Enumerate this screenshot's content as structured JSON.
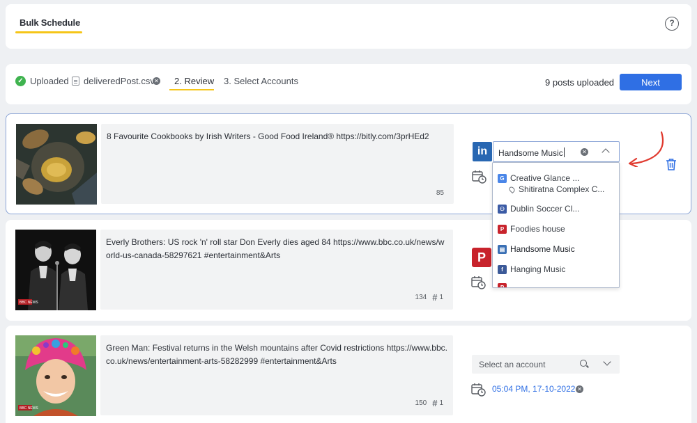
{
  "header": {
    "tab_label": "Bulk Schedule",
    "help_label": "?"
  },
  "steps": {
    "uploaded_label": "Uploaded",
    "file_name": "deliveredPost.csv",
    "step2_label": "2. Review",
    "step3_label": "3. Select Accounts",
    "posts_count_text": "9  posts uploaded",
    "next_label": "Next"
  },
  "posts": [
    {
      "text": "8 Favourite Cookbooks by Irish Writers - Good Food Ireland® https://bitly.com/3prHEd2",
      "char_count": "85",
      "network": "linkedin",
      "network_glyph": "in",
      "account_value": "Handsome Music"
    },
    {
      "text": "Everly Brothers: US rock 'n' roll star Don Everly dies aged 84 https://www.bbc.co.uk/news/world-us-canada-58297621 #entertainment&Arts",
      "char_count": "134",
      "hashtag_count": "1",
      "network": "pinterest",
      "network_glyph": "P"
    },
    {
      "text": "Green Man: Festival returns in the Welsh mountains after Covid restrictions https://www.bbc.co.uk/news/entertainment-arts-58282999 #entertainment&Arts",
      "char_count": "150",
      "hashtag_count": "1",
      "account_placeholder": "Select an account",
      "schedule_time": "05:04 PM, 17-10-2022"
    }
  ],
  "dropdown": {
    "items": [
      {
        "label": "Creative Glance ...",
        "sub_label": "Shitiratna Complex C...",
        "icon": "google-business-icon"
      },
      {
        "label": "Dublin Soccer Cl...",
        "icon": "facebook-group-icon"
      },
      {
        "label": "Foodies house",
        "icon": "pinterest-icon"
      },
      {
        "label": "Handsome Music",
        "icon": "linkedin-page-icon"
      },
      {
        "label": "Hanging Music",
        "icon": "facebook-icon"
      }
    ]
  },
  "colors": {
    "accent": "#2f6fe4",
    "tab_underline": "#f5c518",
    "linkedin": "#2867b2",
    "pinterest": "#c8232c",
    "success": "#3fb34f",
    "arrow": "#e03a2f"
  }
}
